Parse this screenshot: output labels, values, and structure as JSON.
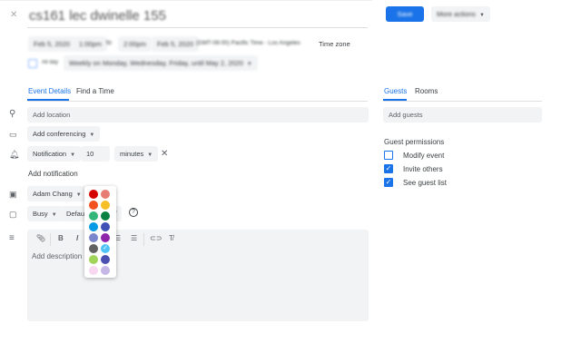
{
  "header": {
    "close_icon": "close-icon",
    "title": "cs161 lec dwinelle 155",
    "save_label": "Save",
    "more_actions_label": "More actions"
  },
  "datetime": {
    "start_date": "Feb 5, 2020",
    "start_time": "1:00pm",
    "to": "to",
    "end_time": "2:00pm",
    "end_date": "Feb 5, 2020",
    "tz": "(GMT-08:00) Pacific Time - Los Angeles",
    "tz_label": "Time zone",
    "all_day": "All day",
    "recurrence": "Weekly on Monday, Wednesday, Friday, until May 2, 2020"
  },
  "tabs": {
    "details": "Event Details",
    "find": "Find a Time",
    "guests": "Guests",
    "rooms": "Rooms"
  },
  "details": {
    "location_placeholder": "Add location",
    "conferencing": "Add conferencing",
    "notification_type": "Notification",
    "notification_value": "10",
    "notification_unit": "minutes",
    "add_notification": "Add notification",
    "calendar": "Adam Chang",
    "availability": "Busy",
    "visibility": "Default visibility",
    "description_placeholder": "Add description"
  },
  "guests": {
    "placeholder": "Add guests",
    "permissions_title": "Guest permissions",
    "permissions": [
      {
        "label": "Modify event",
        "checked": false
      },
      {
        "label": "Invite others",
        "checked": true
      },
      {
        "label": "See guest list",
        "checked": true
      }
    ]
  },
  "colors": [
    "#d50000",
    "#e67c73",
    "#f4511e",
    "#f6bf26",
    "#33b679",
    "#0b8043",
    "#039be5",
    "#3f51b5",
    "#7986cb",
    "#8e24aa",
    "#616161",
    "#4fc3f7",
    "#a0d45a",
    "#4a4fb0",
    "#f8d7f0",
    "#c5b8e6"
  ],
  "selected_color_index": 11,
  "accent": "#1a73e8"
}
